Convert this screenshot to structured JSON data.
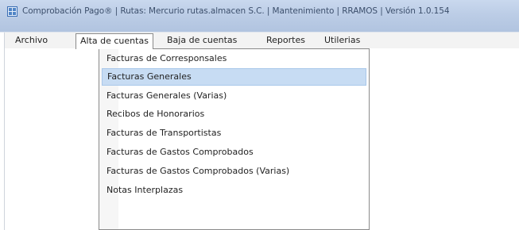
{
  "window": {
    "title": "Comprobación Pago® | Rutas: Mercurio rutas.almacen S.C. | Mantenimiento | RRAMOS | Versión 1.0.154"
  },
  "menubar": {
    "items": [
      {
        "label": "Archivo"
      },
      {
        "label": "Alta de cuentas"
      },
      {
        "label": "Baja de cuentas"
      },
      {
        "label": "Reportes"
      },
      {
        "label": "Utilerias"
      }
    ]
  },
  "dropdown": {
    "parent": "Alta de cuentas",
    "highlighted_index": 1,
    "items": [
      {
        "label": "Facturas de Corresponsales"
      },
      {
        "label": "Facturas Generales"
      },
      {
        "label": "Facturas Generales (Varias)"
      },
      {
        "label": "Recibos de Honorarios"
      },
      {
        "label": "Facturas de Transportistas"
      },
      {
        "label": "Facturas de Gastos Comprobados"
      },
      {
        "label": "Facturas de Gastos Comprobados (Varias)"
      },
      {
        "label": "Notas Interplazas"
      }
    ]
  },
  "colors": {
    "titlebar": "#bccde6",
    "highlight": "#c7dcf3",
    "menubar": "#f3f3f3"
  }
}
